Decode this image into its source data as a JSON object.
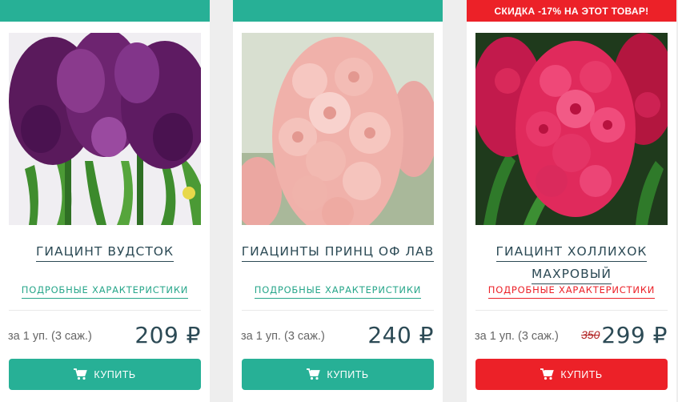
{
  "products": [
    {
      "ribbon": "",
      "title_line1": "ГИАЦИНТ ВУДСТОК",
      "title_line2": "",
      "details_label": "ПОДРОБНЫЕ ХАРАКТЕРИСТИКИ",
      "unit_label": "за 1 уп. (3 саж.)",
      "old_price": "",
      "price": "209 ₽",
      "buy_label": "КУПИТЬ",
      "image_subject": "purple hyacinth"
    },
    {
      "ribbon": "",
      "title_line1": "ГИАЦИНТЫ ПРИНЦ ОФ ЛАВ",
      "title_line2": "",
      "details_label": "ПОДРОБНЫЕ ХАРАКТЕРИСТИКИ",
      "unit_label": "за 1 уп. (3 саж.)",
      "old_price": "",
      "price": "240 ₽",
      "buy_label": "КУПИТЬ",
      "image_subject": "pink double hyacinth"
    },
    {
      "ribbon": "СКИДКА -17% НА ЭТОТ ТОВАР!",
      "title_line1": "ГИАЦИНТ ХОЛЛИХОК",
      "title_line2": "МАХРОВЫЙ",
      "details_label": "ПОДРОБНЫЕ ХАРАКТЕРИСТИКИ",
      "unit_label": "за 1 уп. (3 саж.)",
      "old_price": "350",
      "price": "299 ₽",
      "buy_label": "КУПИТЬ",
      "image_subject": "red double hyacinth"
    }
  ],
  "colors": {
    "accent": "#27b096",
    "sale": "#ec2128",
    "title_text": "#2c4a55",
    "background": "#eeeeee"
  },
  "icons": {
    "buy": "shopping-cart-icon"
  }
}
